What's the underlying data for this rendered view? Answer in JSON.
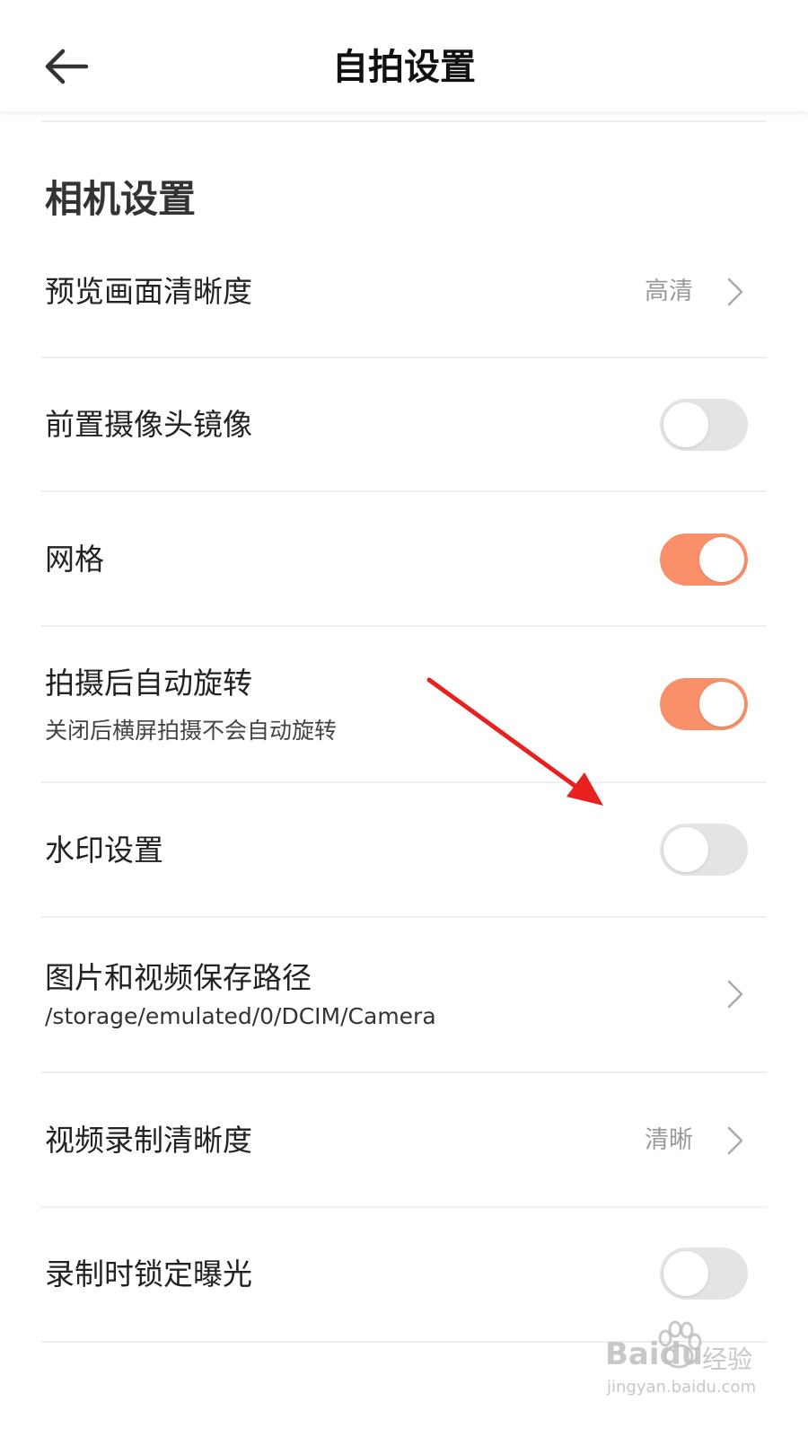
{
  "header": {
    "title": "自拍设置",
    "back_icon": "arrow-left-icon"
  },
  "section": {
    "title": "相机设置"
  },
  "settings": [
    {
      "label": "预览画面清晰度",
      "value": "高清",
      "control": "chevron"
    },
    {
      "label": "前置摄像头镜像",
      "control": "toggle",
      "enabled": false
    },
    {
      "label": "网格",
      "control": "toggle",
      "enabled": true
    },
    {
      "label": "拍摄后自动旋转",
      "subtitle": "关闭后横屏拍摄不会自动旋转",
      "control": "toggle",
      "enabled": true
    },
    {
      "label": "水印设置",
      "control": "toggle",
      "enabled": false
    },
    {
      "label": "图片和视频保存路径",
      "subtitle": "/storage/emulated/0/DCIM/Camera",
      "control": "chevron"
    },
    {
      "label": "视频录制清晰度",
      "value": "清晰",
      "control": "chevron"
    },
    {
      "label": "录制时锁定曝光",
      "control": "toggle",
      "enabled": false
    }
  ],
  "colors": {
    "toggle_on": "#f9906a",
    "toggle_off": "#e4e4e4",
    "annotation_arrow": "#e8201f"
  },
  "watermark": {
    "brand": "Baidu",
    "brand_cn": "经验",
    "url": "jingyan.baidu.com"
  }
}
